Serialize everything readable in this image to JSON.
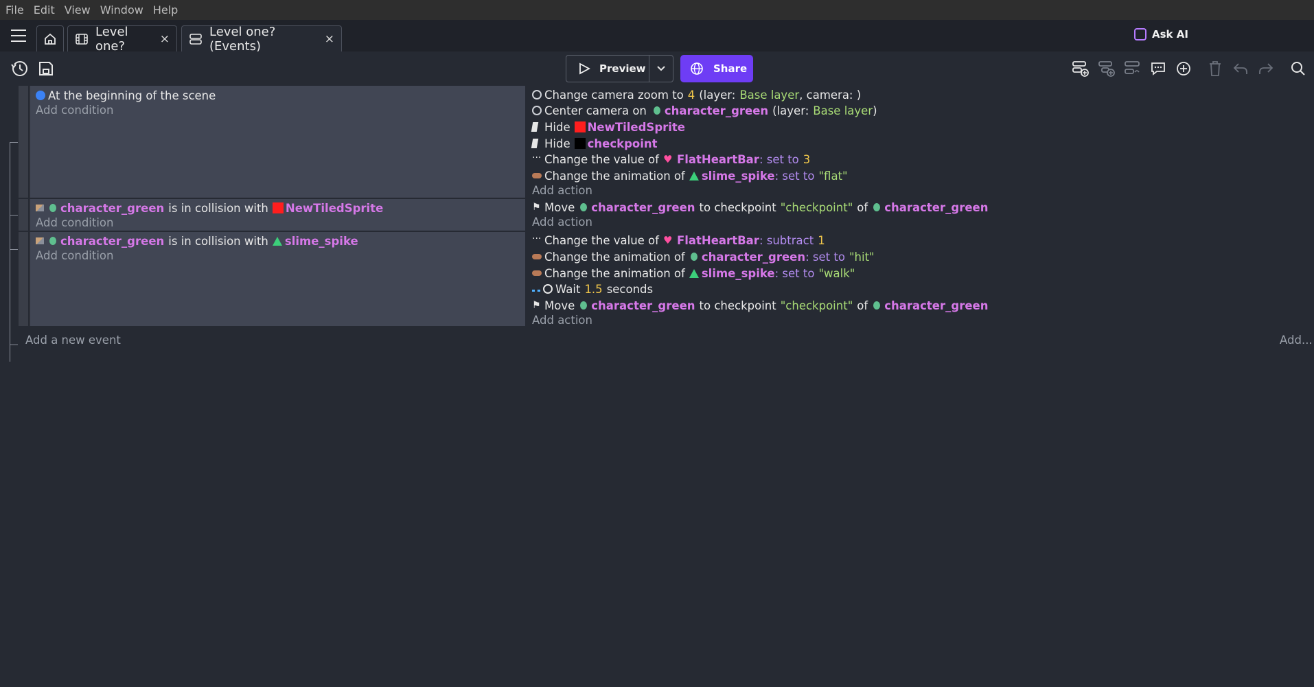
{
  "menu": [
    "File",
    "Edit",
    "View",
    "Window",
    "Help"
  ],
  "tabs": [
    {
      "label": "Level one?",
      "close": "×"
    },
    {
      "label": "Level one? (Events)",
      "close": "×"
    }
  ],
  "ask_ai": "Ask AI",
  "toolbar": {
    "preview": "Preview",
    "share": "Share"
  },
  "colors": {
    "accent": "#6e3df5",
    "object": "#d678e8",
    "number": "#f2c84b",
    "string": "#a9dc76",
    "operator": "#b38cf0"
  },
  "events": [
    {
      "condition": "At the beginning of the scene",
      "add_condition": "Add condition",
      "actions": {
        "zoom": {
          "pre": "Change camera zoom to",
          "value": "4",
          "mid": "(layer:",
          "layer": "Base layer",
          "post": ", camera: )"
        },
        "center": {
          "pre": "Center camera on",
          "obj": "character_green",
          "mid": "(layer:",
          "layer": "Base layer",
          "post": ")"
        },
        "hide1": {
          "pre": "Hide",
          "obj": "NewTiledSprite"
        },
        "hide2": {
          "pre": "Hide",
          "obj": "checkpoint"
        },
        "value": {
          "pre": "Change the value of",
          "obj": "FlatHeartBar",
          "op": ": set to",
          "value": "3"
        },
        "anim": {
          "pre": "Change the animation of",
          "obj": "slime_spike",
          "op": ": set to",
          "value": "\"flat\""
        }
      },
      "add_action": "Add action"
    },
    {
      "cond": {
        "obj1": "character_green",
        "mid": "is in collision with",
        "obj2": "NewTiledSprite"
      },
      "add_condition": "Add condition",
      "move": {
        "pre": "Move",
        "obj": "character_green",
        "mid": "to checkpoint",
        "str": "\"checkpoint\"",
        "of": "of",
        "obj2": "character_green"
      },
      "add_action": "Add action"
    },
    {
      "cond": {
        "obj1": "character_green",
        "mid": "is in collision with",
        "obj2": "slime_spike"
      },
      "add_condition": "Add condition",
      "value": {
        "pre": "Change the value of",
        "obj": "FlatHeartBar",
        "op": ": subtract",
        "value": "1"
      },
      "anim1": {
        "pre": "Change the animation of",
        "obj": "character_green",
        "op": ": set to",
        "value": "\"hit\""
      },
      "anim2": {
        "pre": "Change the animation of",
        "obj": "slime_spike",
        "op": ": set to",
        "value": "\"walk\""
      },
      "wait": {
        "pre": "Wait",
        "value": "1.5",
        "post": "seconds"
      },
      "move": {
        "pre": "Move",
        "obj": "character_green",
        "mid": "to checkpoint",
        "str": "\"checkpoint\"",
        "of": "of",
        "obj2": "character_green"
      },
      "add_action": "Add action"
    }
  ],
  "add_event": "Add a new event",
  "add_menu": "Add..."
}
